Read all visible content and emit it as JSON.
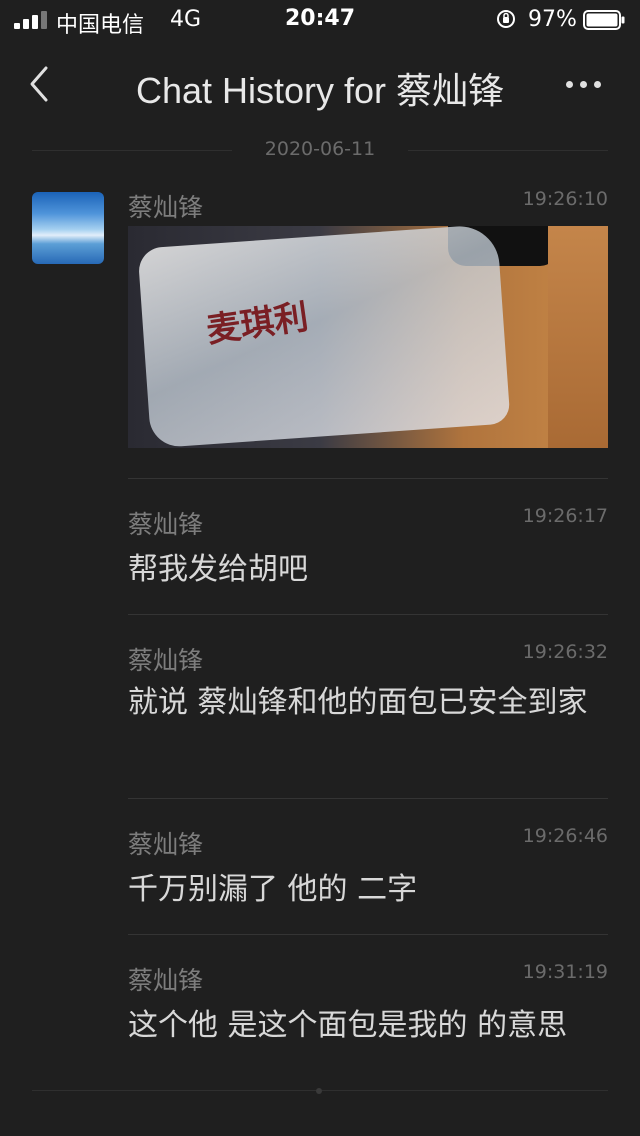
{
  "status_bar": {
    "carrier": "中国电信",
    "network": "4G",
    "time": "20:47",
    "battery": "97%"
  },
  "nav": {
    "title": "Chat History for 蔡灿锋",
    "back_icon": "chevron-left-icon",
    "more_icon": "more-horizontal-icon"
  },
  "date_divider": "2020-06-11",
  "messages": [
    {
      "sender": "蔡灿锋",
      "time": "19:26:10",
      "type": "image"
    },
    {
      "sender": "蔡灿锋",
      "time": "19:26:17",
      "text": "帮我发给胡吧"
    },
    {
      "sender": "蔡灿锋",
      "time": "19:26:32",
      "text": "就说 蔡灿锋和他的面包已安全到家"
    },
    {
      "sender": "蔡灿锋",
      "time": "19:26:46",
      "text": "千万别漏了 他的 二字"
    },
    {
      "sender": "蔡灿锋",
      "time": "19:31:19",
      "text": "这个他 是这个面包是我的 的意思"
    }
  ],
  "photo": {
    "bag_text": "麦琪利"
  }
}
